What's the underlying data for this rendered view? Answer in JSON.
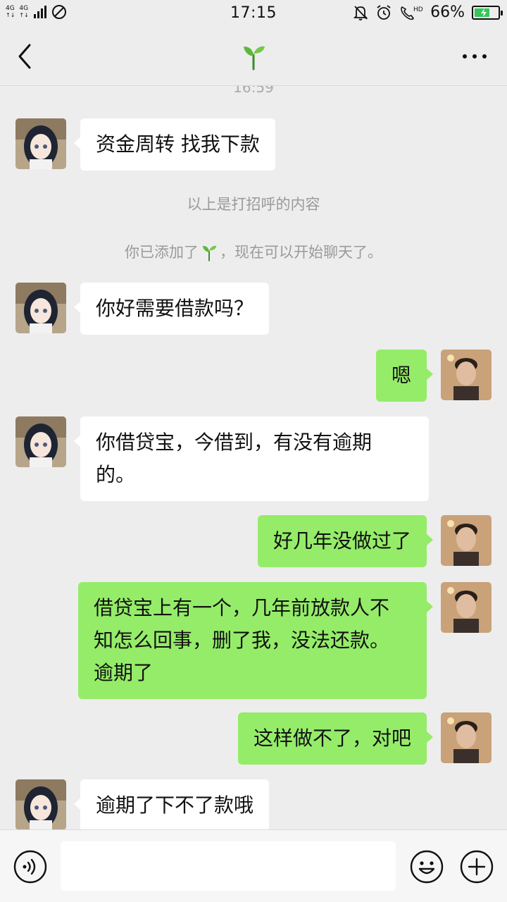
{
  "status_bar": {
    "network": [
      "4G",
      "4G"
    ],
    "time": "17:15",
    "battery_text": "66%",
    "battery_level": 0.66,
    "icons": [
      "signal-icon",
      "no-sim-icon",
      "mute-icon",
      "alarm-icon",
      "hd-call-icon",
      "battery-icon"
    ]
  },
  "header": {
    "back_icon": "chevron-left-icon",
    "title_icon": "sprout-icon",
    "more_icon": "more-dots-icon"
  },
  "chat": {
    "timestamp": "16:59",
    "system_notes": {
      "greeting_note": "以上是打招呼的内容",
      "added_prefix": "你已添加了",
      "added_suffix": "，现在可以开始聊天了。"
    },
    "messages": [
      {
        "side": "in",
        "text": "资金周转 找我下款"
      },
      {
        "side": "in",
        "text": "你好需要借款吗？"
      },
      {
        "side": "out",
        "text": "嗯"
      },
      {
        "side": "in",
        "text_line1": "你借贷宝，今借到，有没有逾期",
        "text_line2": "的。"
      },
      {
        "side": "out",
        "text": "好几年没做过了"
      },
      {
        "side": "out",
        "text_line1": "借贷宝上有一个，几年前放款人不",
        "text_line2": "知怎么回事，删了我，没法还款。",
        "text_line3": "逾期了"
      },
      {
        "side": "out",
        "text": "这样做不了，对吧"
      },
      {
        "side": "in",
        "text": "逾期了下不了款哦"
      }
    ]
  },
  "input_bar": {
    "voice_icon": "voice-icon",
    "placeholder": "",
    "emoji_icon": "emoji-icon",
    "plus_icon": "plus-icon"
  },
  "colors": {
    "background": "#ededed",
    "incoming_bubble": "#ffffff",
    "outgoing_bubble": "#95ec69",
    "system_text": "#9a9a9a"
  }
}
